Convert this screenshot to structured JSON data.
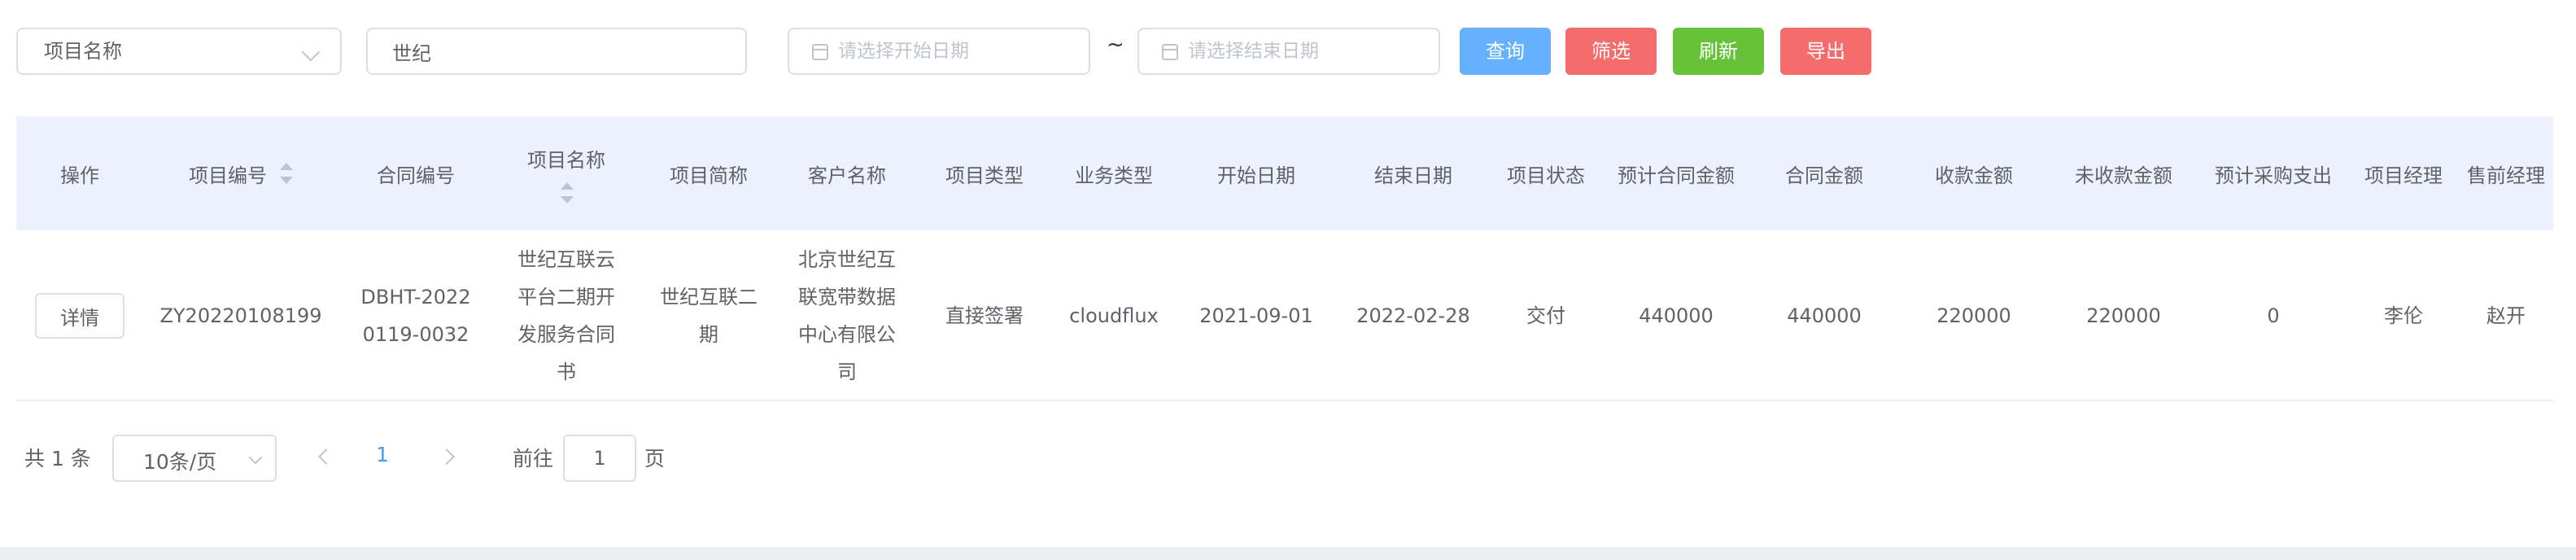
{
  "filters": {
    "field_select": "项目名称",
    "keyword": "世纪",
    "start_placeholder": "请选择开始日期",
    "end_placeholder": "请选择结束日期",
    "range_separator": "~"
  },
  "buttons": {
    "query": "查询",
    "filter": "筛选",
    "refresh": "刷新",
    "export": "导出"
  },
  "colors": {
    "query": "#66b1ff",
    "filter": "#f56c6c",
    "refresh": "#67c23a",
    "export": "#f56c6c",
    "header_bg": "#edf0fd",
    "active_page": "#409eff"
  },
  "table": {
    "headers": [
      "操作",
      "项目编号",
      "合同编号",
      "项目名称",
      "项目简称",
      "客户名称",
      "项目类型",
      "业务类型",
      "开始日期",
      "结束日期",
      "项目状态",
      "预计合同金额",
      "合同金额",
      "收款金额",
      "未收款金额",
      "预计采购支出",
      "项目经理",
      "售前经理"
    ],
    "rows": [
      {
        "action": "详情",
        "project_no": "ZY20220108199",
        "contract_no": [
          "DBHT-2022",
          "0119-0032"
        ],
        "project_name": [
          "世纪互联云",
          "平台二期开",
          "发服务合同",
          "书"
        ],
        "project_abbr": [
          "世纪互联二",
          "期"
        ],
        "customer": [
          "北京世纪互",
          "联宽带数据",
          "中心有限公",
          "司"
        ],
        "project_type": "直接签署",
        "biz_type": "cloudflux",
        "start_date": "2021-09-01",
        "end_date": "2022-02-28",
        "status": "交付",
        "est_contract_amount": "440000",
        "contract_amount": "440000",
        "received_amount": "220000",
        "unreceived_amount": "220000",
        "est_purchase": "0",
        "pm": "李伦",
        "presales": "赵开"
      }
    ]
  },
  "pagination": {
    "total": "共 1 条",
    "page_size": "10条/页",
    "current_page": "1",
    "goto_label": "前往",
    "goto_value": "1",
    "page_unit": "页"
  }
}
